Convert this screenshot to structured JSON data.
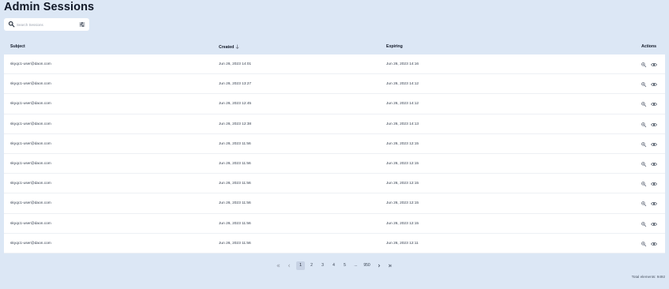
{
  "page": {
    "title": "Admin Sessions"
  },
  "search": {
    "placeholder": "Search Sessions"
  },
  "table": {
    "headers": {
      "subject": "Subject",
      "created": "Created",
      "expiring": "Expiring",
      "actions": "Actions"
    },
    "rows": [
      {
        "subject": "skyqc1-user@daon.com",
        "created": "Jun 26, 2023 14:01",
        "expiring": "Jun 26, 2023 14:16"
      },
      {
        "subject": "skyqc1-user@daon.com",
        "created": "Jun 26, 2023 13:27",
        "expiring": "Jun 26, 2023 14:12"
      },
      {
        "subject": "skyqc1-user@daon.com",
        "created": "Jun 26, 2023 12:45",
        "expiring": "Jun 26, 2023 14:12"
      },
      {
        "subject": "skyqc1-user@daon.com",
        "created": "Jun 26, 2023 12:38",
        "expiring": "Jun 26, 2023 14:13"
      },
      {
        "subject": "skyqc1-user@daon.com",
        "created": "Jun 26, 2023 11:56",
        "expiring": "Jun 26, 2023 12:15"
      },
      {
        "subject": "skyqc1-user@daon.com",
        "created": "Jun 26, 2023 11:56",
        "expiring": "Jun 26, 2023 12:15"
      },
      {
        "subject": "skyqc1-user@daon.com",
        "created": "Jun 26, 2023 11:56",
        "expiring": "Jun 26, 2023 12:15"
      },
      {
        "subject": "skyqc1-user@daon.com",
        "created": "Jun 26, 2023 11:56",
        "expiring": "Jun 26, 2023 12:15"
      },
      {
        "subject": "skyqc1-user@daon.com",
        "created": "Jun 26, 2023 11:56",
        "expiring": "Jun 26, 2023 12:15"
      },
      {
        "subject": "skyqc1-user@daon.com",
        "created": "Jun 26, 2023 11:56",
        "expiring": "Jun 26, 2023 12:11"
      }
    ],
    "row_actions": [
      "zoom-icon",
      "eye-icon"
    ]
  },
  "pagination": {
    "pages": [
      "1",
      "2",
      "3",
      "4",
      "5",
      "...",
      "950"
    ],
    "current": "1"
  },
  "footer": {
    "total": "Total elements: 9492"
  },
  "colors": {
    "background": "#dce7f5",
    "surface": "#ffffff",
    "active_page": "#c7d2e4"
  }
}
